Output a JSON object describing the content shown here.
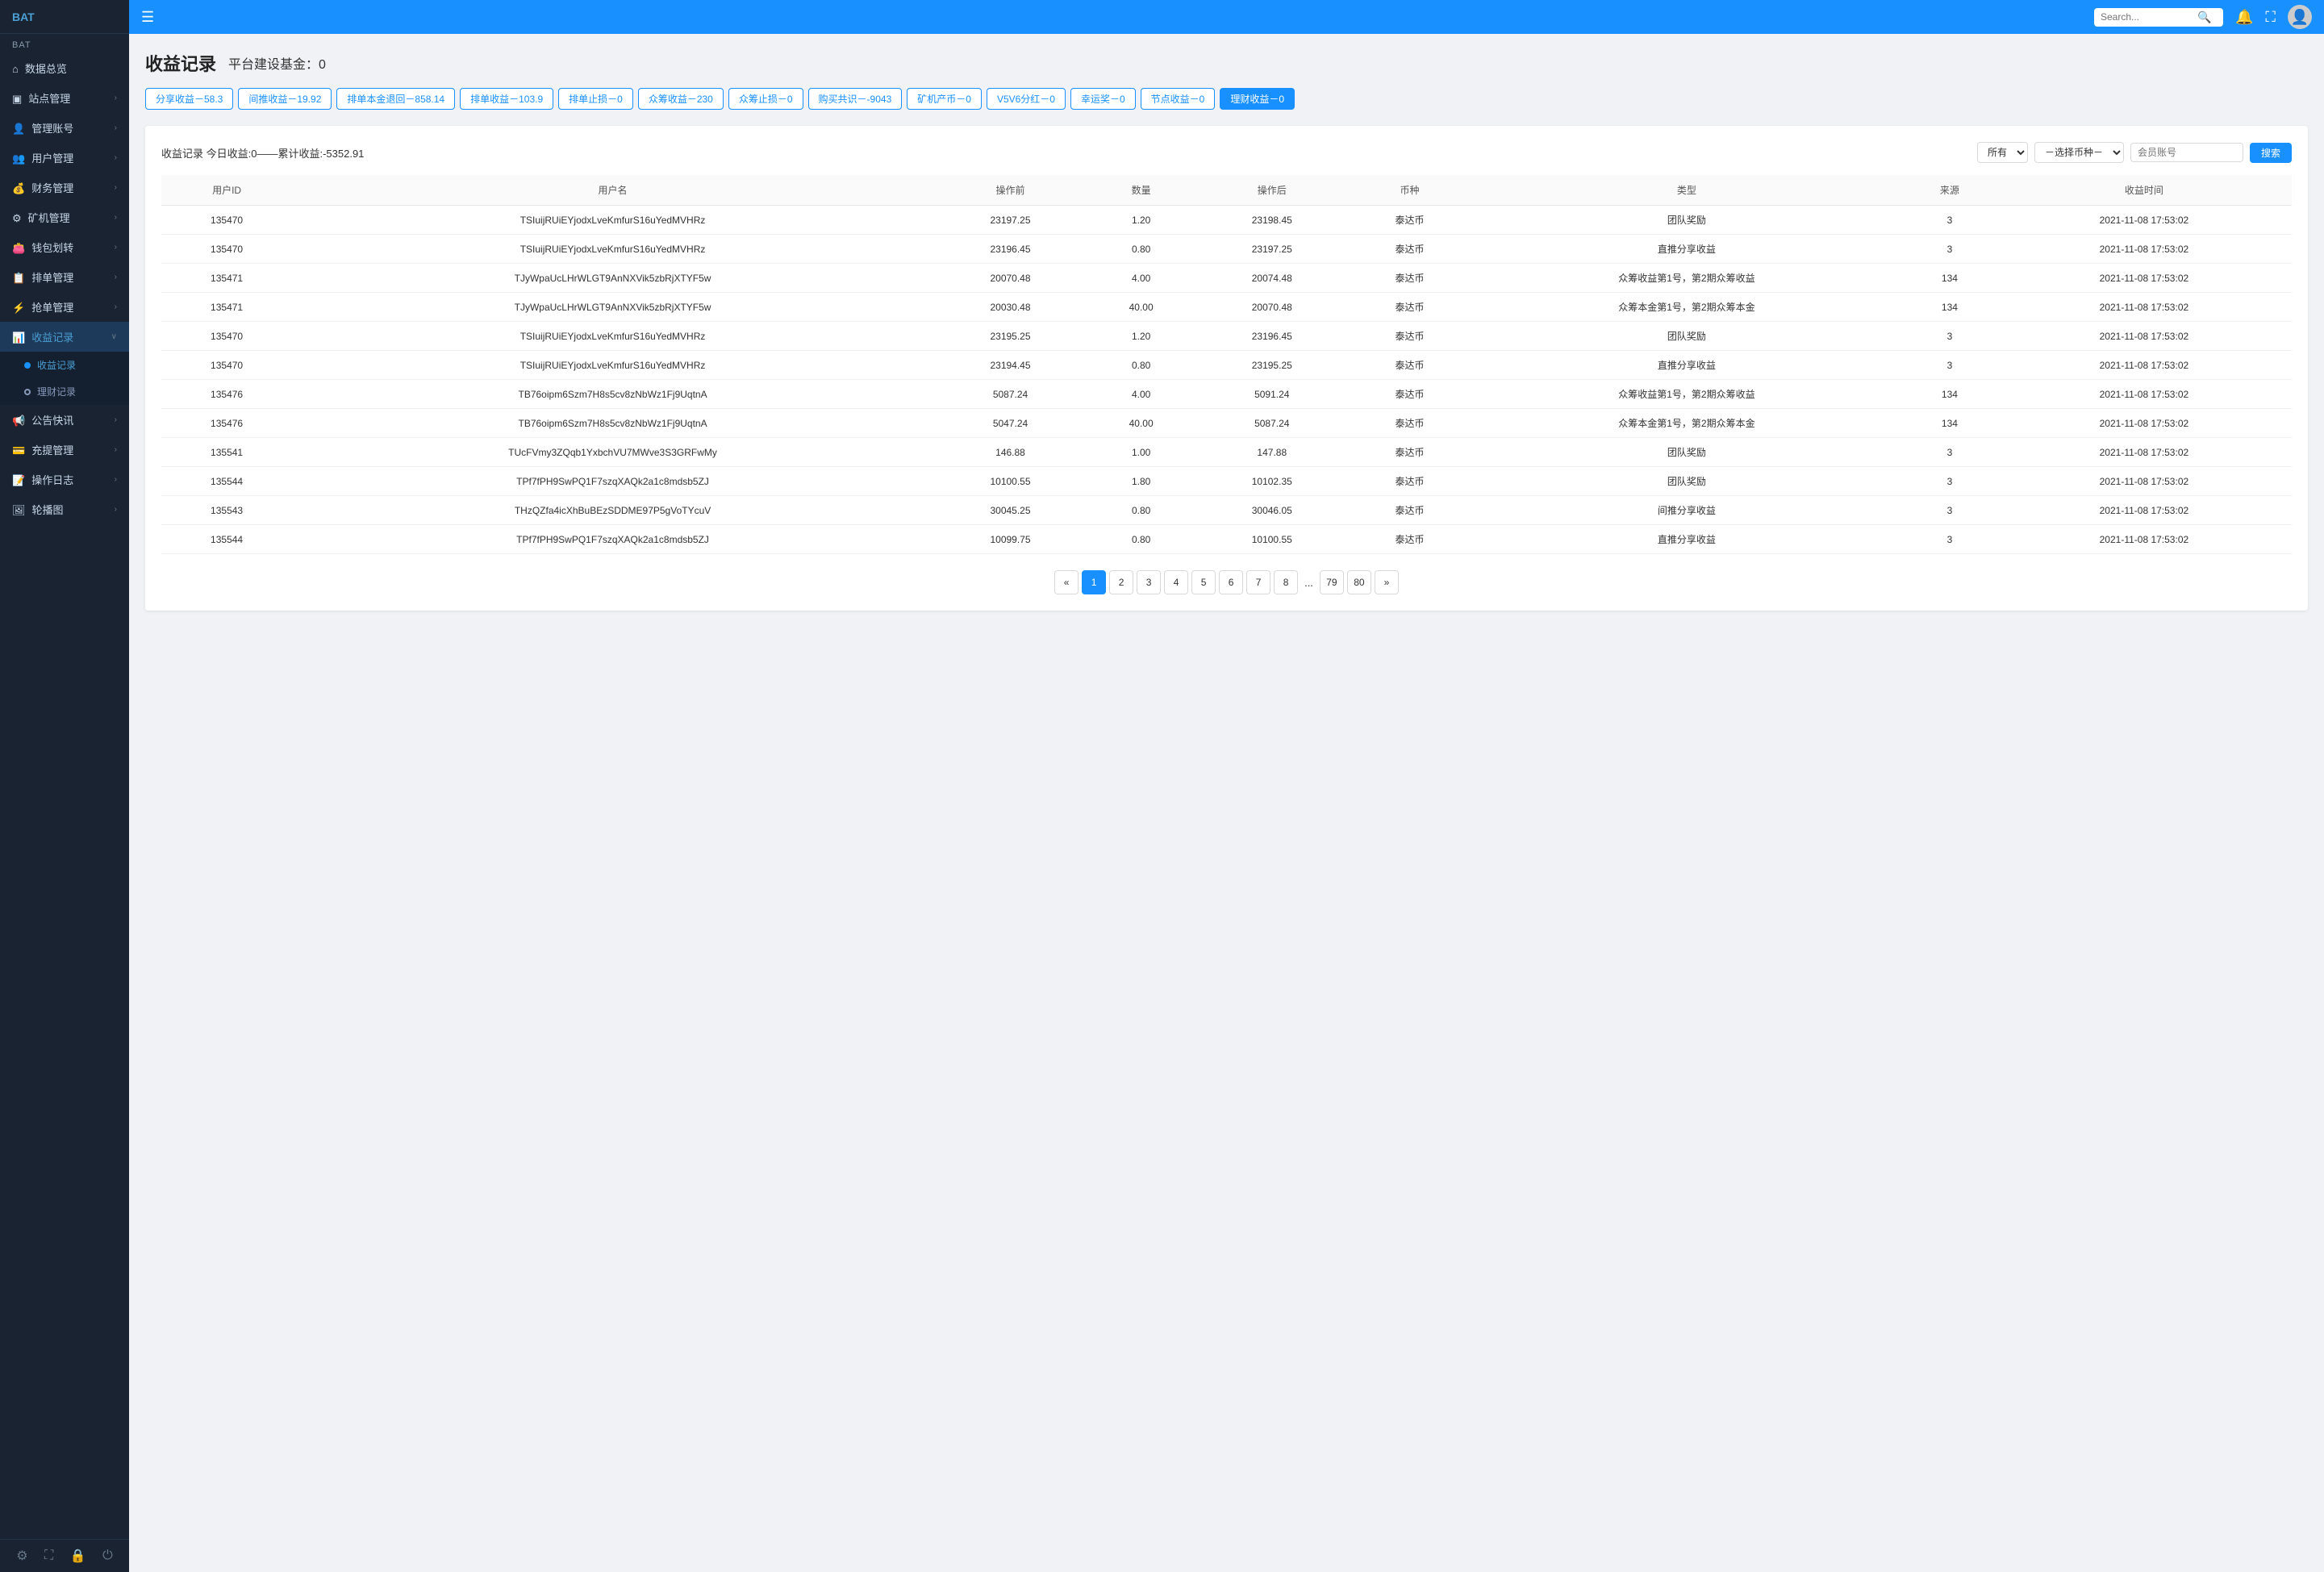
{
  "app": {
    "logo": "BAT",
    "search_placeholder": "Search..."
  },
  "sidebar": {
    "section": "BAT",
    "items": [
      {
        "id": "dashboard",
        "label": "数据总览",
        "icon": "⌂",
        "has_arrow": false,
        "expanded": false
      },
      {
        "id": "site",
        "label": "站点管理",
        "icon": "◫",
        "has_arrow": true,
        "expanded": false
      },
      {
        "id": "account",
        "label": "管理账号",
        "icon": "👤",
        "has_arrow": true,
        "expanded": false
      },
      {
        "id": "users",
        "label": "用户管理",
        "icon": "👥",
        "has_arrow": true,
        "expanded": false
      },
      {
        "id": "finance",
        "label": "财务管理",
        "icon": "💰",
        "has_arrow": true,
        "expanded": false
      },
      {
        "id": "mining",
        "label": "矿机管理",
        "icon": "⚙",
        "has_arrow": true,
        "expanded": false
      },
      {
        "id": "wallet",
        "label": "钱包划转",
        "icon": "👛",
        "has_arrow": true,
        "expanded": false
      },
      {
        "id": "order",
        "label": "排单管理",
        "icon": "📋",
        "has_arrow": true,
        "expanded": false
      },
      {
        "id": "grab",
        "label": "抢单管理",
        "icon": "⚡",
        "has_arrow": true,
        "expanded": false
      },
      {
        "id": "income",
        "label": "收益记录",
        "icon": "📊",
        "has_arrow": false,
        "expanded": true
      },
      {
        "id": "announce",
        "label": "公告快讯",
        "icon": "📢",
        "has_arrow": true,
        "expanded": false
      },
      {
        "id": "recharge",
        "label": "充提管理",
        "icon": "💳",
        "has_arrow": true,
        "expanded": false
      },
      {
        "id": "oplog",
        "label": "操作日志",
        "icon": "📝",
        "has_arrow": true,
        "expanded": false
      },
      {
        "id": "banner",
        "label": "轮播图",
        "icon": "🖼",
        "has_arrow": true,
        "expanded": false
      }
    ],
    "sub_items": [
      {
        "id": "income-record",
        "label": "收益记录",
        "active": true
      },
      {
        "id": "finance-record",
        "label": "理财记录",
        "active": false
      }
    ],
    "footer_icons": [
      "⚙",
      "⛶",
      "🔒",
      "⏻"
    ]
  },
  "header": {
    "menu_icon": "☰",
    "search_placeholder": "Search...",
    "bell_icon": "🔔",
    "expand_icon": "⛶",
    "avatar_icon": "👤"
  },
  "page": {
    "title": "收益记录",
    "subtitle": "平台建设基金：0"
  },
  "filter_tabs": [
    {
      "id": "share",
      "label": "分享收益－58.3",
      "active": false
    },
    {
      "id": "recommend",
      "label": "间推收益－19.92",
      "active": false
    },
    {
      "id": "order-refund",
      "label": "排单本金退回－858.14",
      "active": false
    },
    {
      "id": "order-income",
      "label": "排单收益－103.9",
      "active": false
    },
    {
      "id": "order-stop",
      "label": "排单止损－0",
      "active": false
    },
    {
      "id": "crowd-income",
      "label": "众筹收益－230",
      "active": false
    },
    {
      "id": "crowd-stop",
      "label": "众筹止损－0",
      "active": false
    },
    {
      "id": "buy-common",
      "label": "购买共识－-9043",
      "active": false
    },
    {
      "id": "miner-coin",
      "label": "矿机产币－0",
      "active": false
    },
    {
      "id": "v5v6",
      "label": "V5V6分红－0",
      "active": false
    },
    {
      "id": "lucky",
      "label": "幸运奖－0",
      "active": false
    },
    {
      "id": "node-income",
      "label": "节点收益－0",
      "active": false
    },
    {
      "id": "finance-income",
      "label": "理财收益－0",
      "active": true
    }
  ],
  "toolbar": {
    "info_prefix": "收益记录 今日收益:0——累计收益:",
    "cumulative": "-5352.91",
    "select_all_label": "所有",
    "select_coin_label": "－选择币种－",
    "account_placeholder": "会员账号",
    "search_button": "搜索"
  },
  "table": {
    "columns": [
      "用户ID",
      "用户名",
      "操作前",
      "数量",
      "操作后",
      "币种",
      "类型",
      "来源",
      "收益时间"
    ],
    "rows": [
      {
        "id": "135470",
        "username": "TSIuijRUiEYjodxLveKmfurS16uYedMVHRz",
        "before": "23197.25",
        "amount": "1.20",
        "after": "23198.45",
        "coin": "泰达币",
        "type": "团队奖励",
        "source": "3",
        "time": "2021-11-08 17:53:02"
      },
      {
        "id": "135470",
        "username": "TSIuijRUiEYjodxLveKmfurS16uYedMVHRz",
        "before": "23196.45",
        "amount": "0.80",
        "after": "23197.25",
        "coin": "泰达币",
        "type": "直推分享收益",
        "source": "3",
        "time": "2021-11-08 17:53:02"
      },
      {
        "id": "135471",
        "username": "TJyWpaUcLHrWLGT9AnNXVik5zbRjXTYF5w",
        "before": "20070.48",
        "amount": "4.00",
        "after": "20074.48",
        "coin": "泰达币",
        "type": "众筹收益第1号，第2期众筹收益",
        "source": "134",
        "time": "2021-11-08 17:53:02"
      },
      {
        "id": "135471",
        "username": "TJyWpaUcLHrWLGT9AnNXVik5zbRjXTYF5w",
        "before": "20030.48",
        "amount": "40.00",
        "after": "20070.48",
        "coin": "泰达币",
        "type": "众筹本金第1号，第2期众筹本金",
        "source": "134",
        "time": "2021-11-08 17:53:02"
      },
      {
        "id": "135470",
        "username": "TSIuijRUiEYjodxLveKmfurS16uYedMVHRz",
        "before": "23195.25",
        "amount": "1.20",
        "after": "23196.45",
        "coin": "泰达币",
        "type": "团队奖励",
        "source": "3",
        "time": "2021-11-08 17:53:02"
      },
      {
        "id": "135470",
        "username": "TSIuijRUiEYjodxLveKmfurS16uYedMVHRz",
        "before": "23194.45",
        "amount": "0.80",
        "after": "23195.25",
        "coin": "泰达币",
        "type": "直推分享收益",
        "source": "3",
        "time": "2021-11-08 17:53:02"
      },
      {
        "id": "135476",
        "username": "TB76oipm6Szm7H8s5cv8zNbWz1Fj9UqtnA",
        "before": "5087.24",
        "amount": "4.00",
        "after": "5091.24",
        "coin": "泰达币",
        "type": "众筹收益第1号，第2期众筹收益",
        "source": "134",
        "time": "2021-11-08 17:53:02"
      },
      {
        "id": "135476",
        "username": "TB76oipm6Szm7H8s5cv8zNbWz1Fj9UqtnA",
        "before": "5047.24",
        "amount": "40.00",
        "after": "5087.24",
        "coin": "泰达币",
        "type": "众筹本金第1号，第2期众筹本金",
        "source": "134",
        "time": "2021-11-08 17:53:02"
      },
      {
        "id": "135541",
        "username": "TUcFVmy3ZQqb1YxbchVU7MWve3S3GRFwMy",
        "before": "146.88",
        "amount": "1.00",
        "after": "147.88",
        "coin": "泰达币",
        "type": "团队奖励",
        "source": "3",
        "time": "2021-11-08 17:53:02"
      },
      {
        "id": "135544",
        "username": "TPf7fPH9SwPQ1F7szqXAQk2a1c8mdsb5ZJ",
        "before": "10100.55",
        "amount": "1.80",
        "after": "10102.35",
        "coin": "泰达币",
        "type": "团队奖励",
        "source": "3",
        "time": "2021-11-08 17:53:02"
      },
      {
        "id": "135543",
        "username": "THzQZfa4icXhBuBEzSDDME97P5gVoTYcuV",
        "before": "30045.25",
        "amount": "0.80",
        "after": "30046.05",
        "coin": "泰达币",
        "type": "间推分享收益",
        "source": "3",
        "time": "2021-11-08 17:53:02"
      },
      {
        "id": "135544",
        "username": "TPf7fPH9SwPQ1F7szqXAQk2a1c8mdsb5ZJ",
        "before": "10099.75",
        "amount": "0.80",
        "after": "10100.55",
        "coin": "泰达币",
        "type": "直推分享收益",
        "source": "3",
        "time": "2021-11-08 17:53:02"
      }
    ]
  },
  "pagination": {
    "prev": "«",
    "next": "»",
    "ellipsis": "...",
    "pages": [
      "1",
      "2",
      "3",
      "4",
      "5",
      "6",
      "7",
      "8"
    ],
    "tail_pages": [
      "79",
      "80"
    ],
    "current": "1"
  }
}
